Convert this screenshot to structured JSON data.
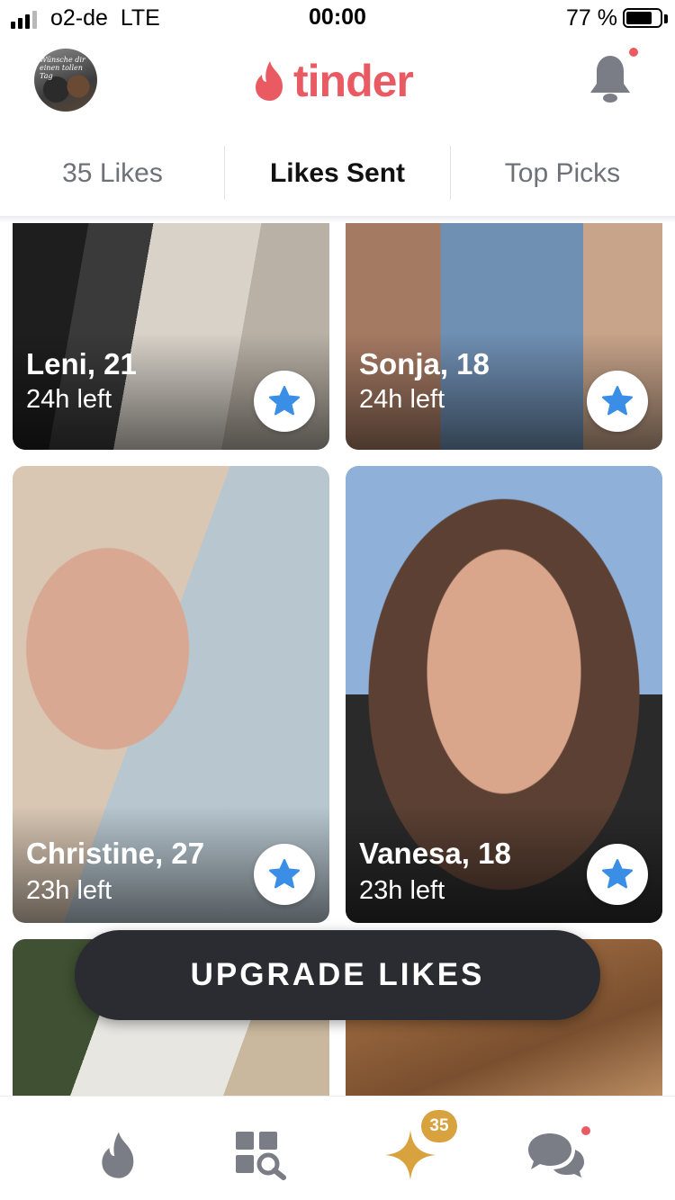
{
  "status_bar": {
    "carrier": "o2-de",
    "network": "LTE",
    "time": "00:00",
    "battery_percent": "77 %",
    "battery_level": 0.77,
    "signal_bars_filled": 3,
    "signal_bars_total": 4
  },
  "header": {
    "avatar_caption": "Wünsche dir einen tollen Tag",
    "logo": "tinder",
    "brand_color": "#ea5a63",
    "bell_icon": "bell-icon",
    "bell_has_notification": true
  },
  "tabs": [
    {
      "label": "35 Likes",
      "active": false
    },
    {
      "label": "Likes Sent",
      "active": true
    },
    {
      "label": "Top Picks",
      "active": false
    }
  ],
  "cards": [
    {
      "name": "Leni, 21",
      "time_left": "24h left",
      "icon": "star-icon"
    },
    {
      "name": "Sonja, 18",
      "time_left": "24h left",
      "icon": "star-icon"
    },
    {
      "name": "Christine, 27",
      "time_left": "23h left",
      "icon": "star-icon"
    },
    {
      "name": "Vanesa, 18",
      "time_left": "23h left",
      "icon": "star-icon"
    }
  ],
  "upgrade_button": {
    "label": "UPGRADE LIKES"
  },
  "bottom_nav": {
    "items": [
      {
        "icon": "flame-icon"
      },
      {
        "icon": "explore-icon"
      },
      {
        "icon": "sparkle-icon",
        "badge": "35"
      },
      {
        "icon": "chat-icon",
        "has_notification": true
      }
    ]
  },
  "colors": {
    "star_blue": "#3a8ee6",
    "gold": "#d8a33f",
    "inactive_icon": "#7a7d85",
    "pill": "#2b2c31"
  }
}
